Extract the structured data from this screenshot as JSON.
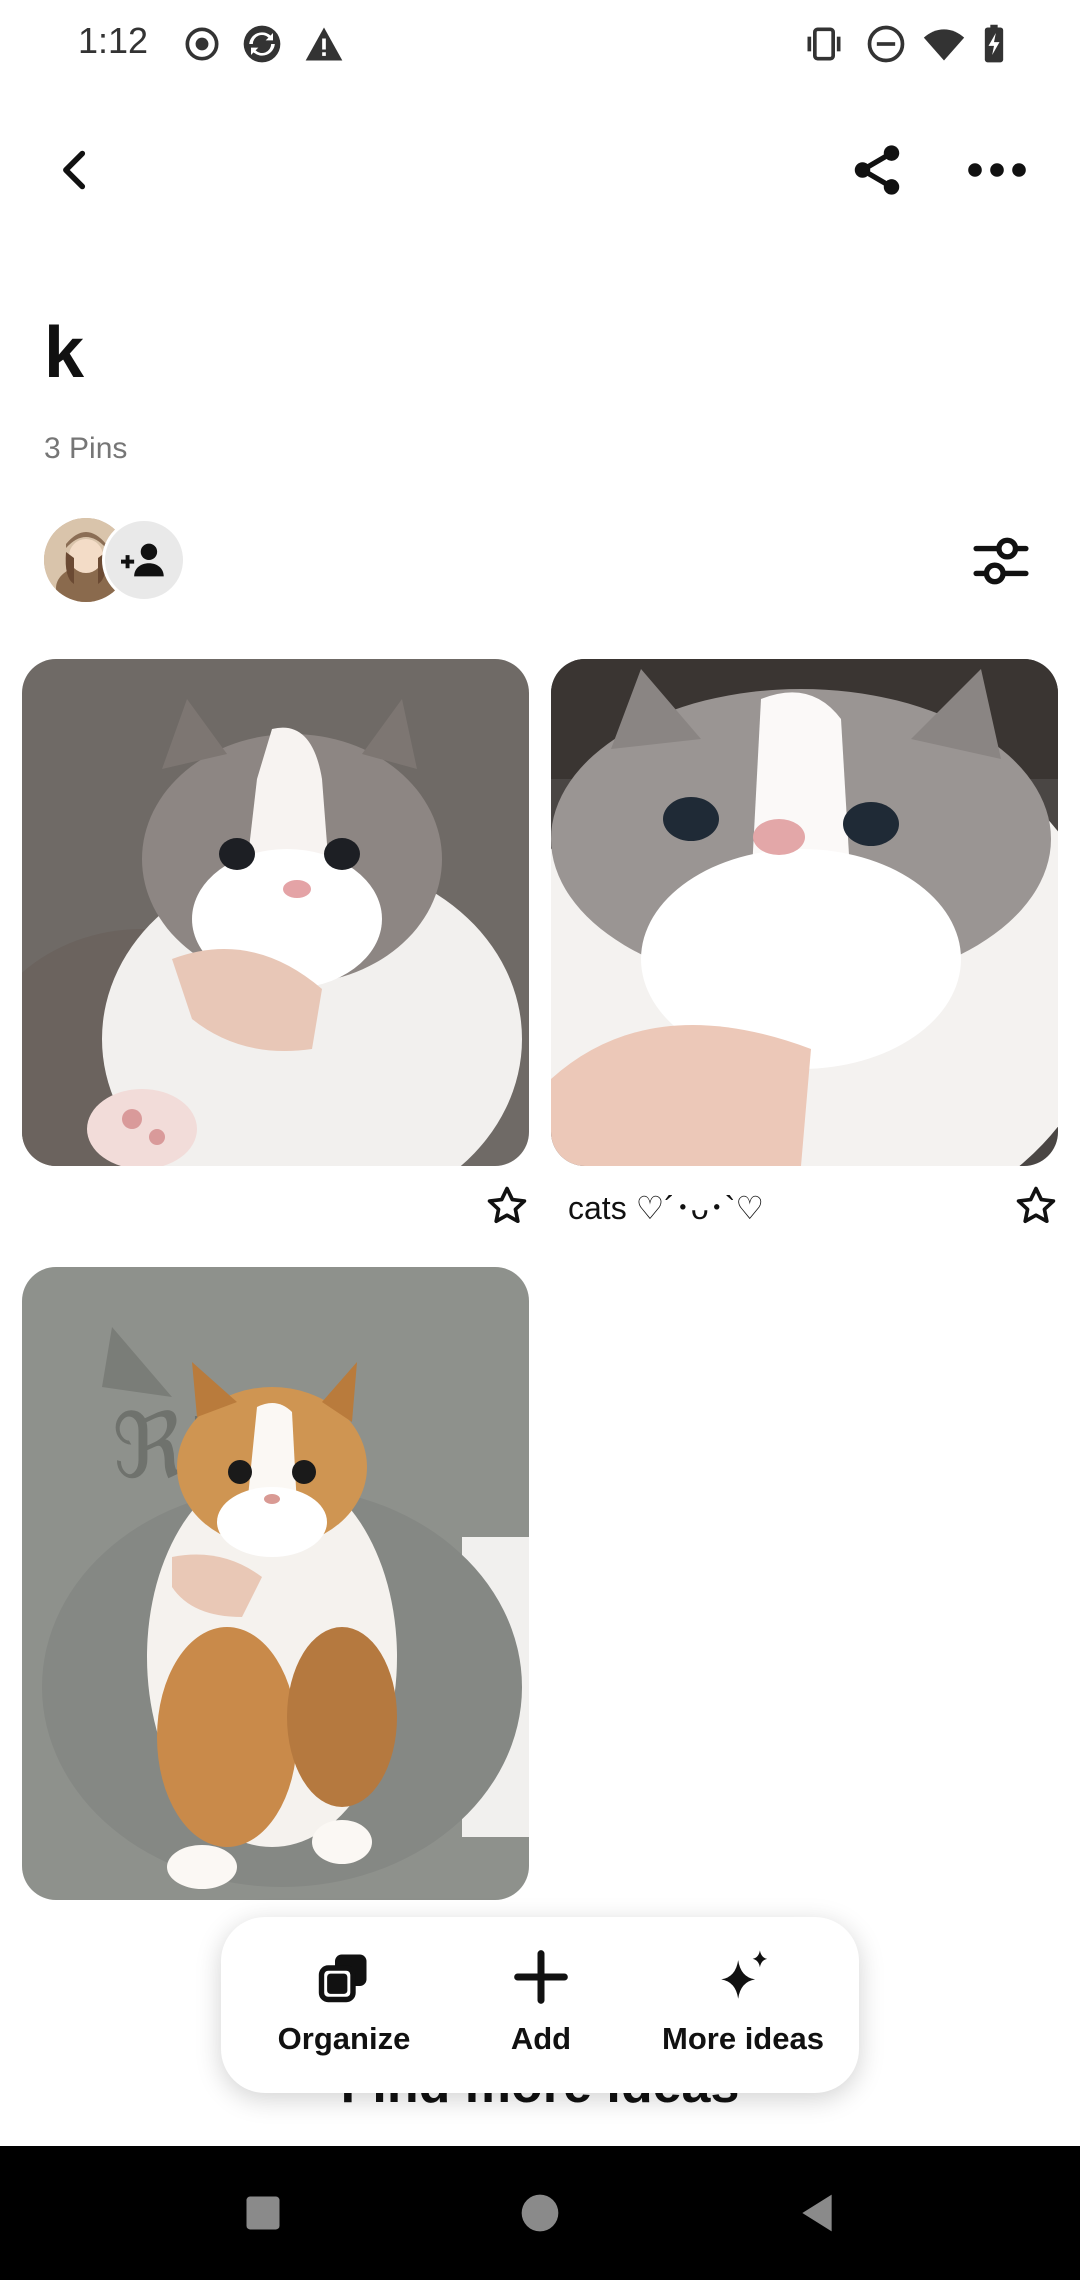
{
  "status_bar": {
    "time": "1:12",
    "left_icons": [
      "record-icon",
      "sync-app-icon",
      "warning-icon"
    ],
    "right_icons": [
      "vibrate-icon",
      "dnd-icon",
      "wifi-icon",
      "battery-charging-icon"
    ]
  },
  "header": {
    "back_icon": "chevron-left-icon",
    "share_icon": "share-icon",
    "more_icon": "more-horizontal-icon"
  },
  "board": {
    "title": "k",
    "pin_count": "3 Pins"
  },
  "pins": [
    {
      "caption": "",
      "alt": "grey and white kitten held by hand"
    },
    {
      "caption": "cats ♡´･ᴗ･`♡",
      "alt": "grey and white cat close-up"
    },
    {
      "caption": "",
      "alt": "calico fluffy kitten held on lap"
    }
  ],
  "footer": {
    "find_more": "Find more ideas"
  },
  "action_bar": {
    "organize_label": "Organize",
    "add_label": "Add",
    "more_ideas_label": "More ideas"
  },
  "colors": {
    "text_primary": "#111111",
    "text_secondary": "#767676",
    "nav_bar": "#000000"
  }
}
